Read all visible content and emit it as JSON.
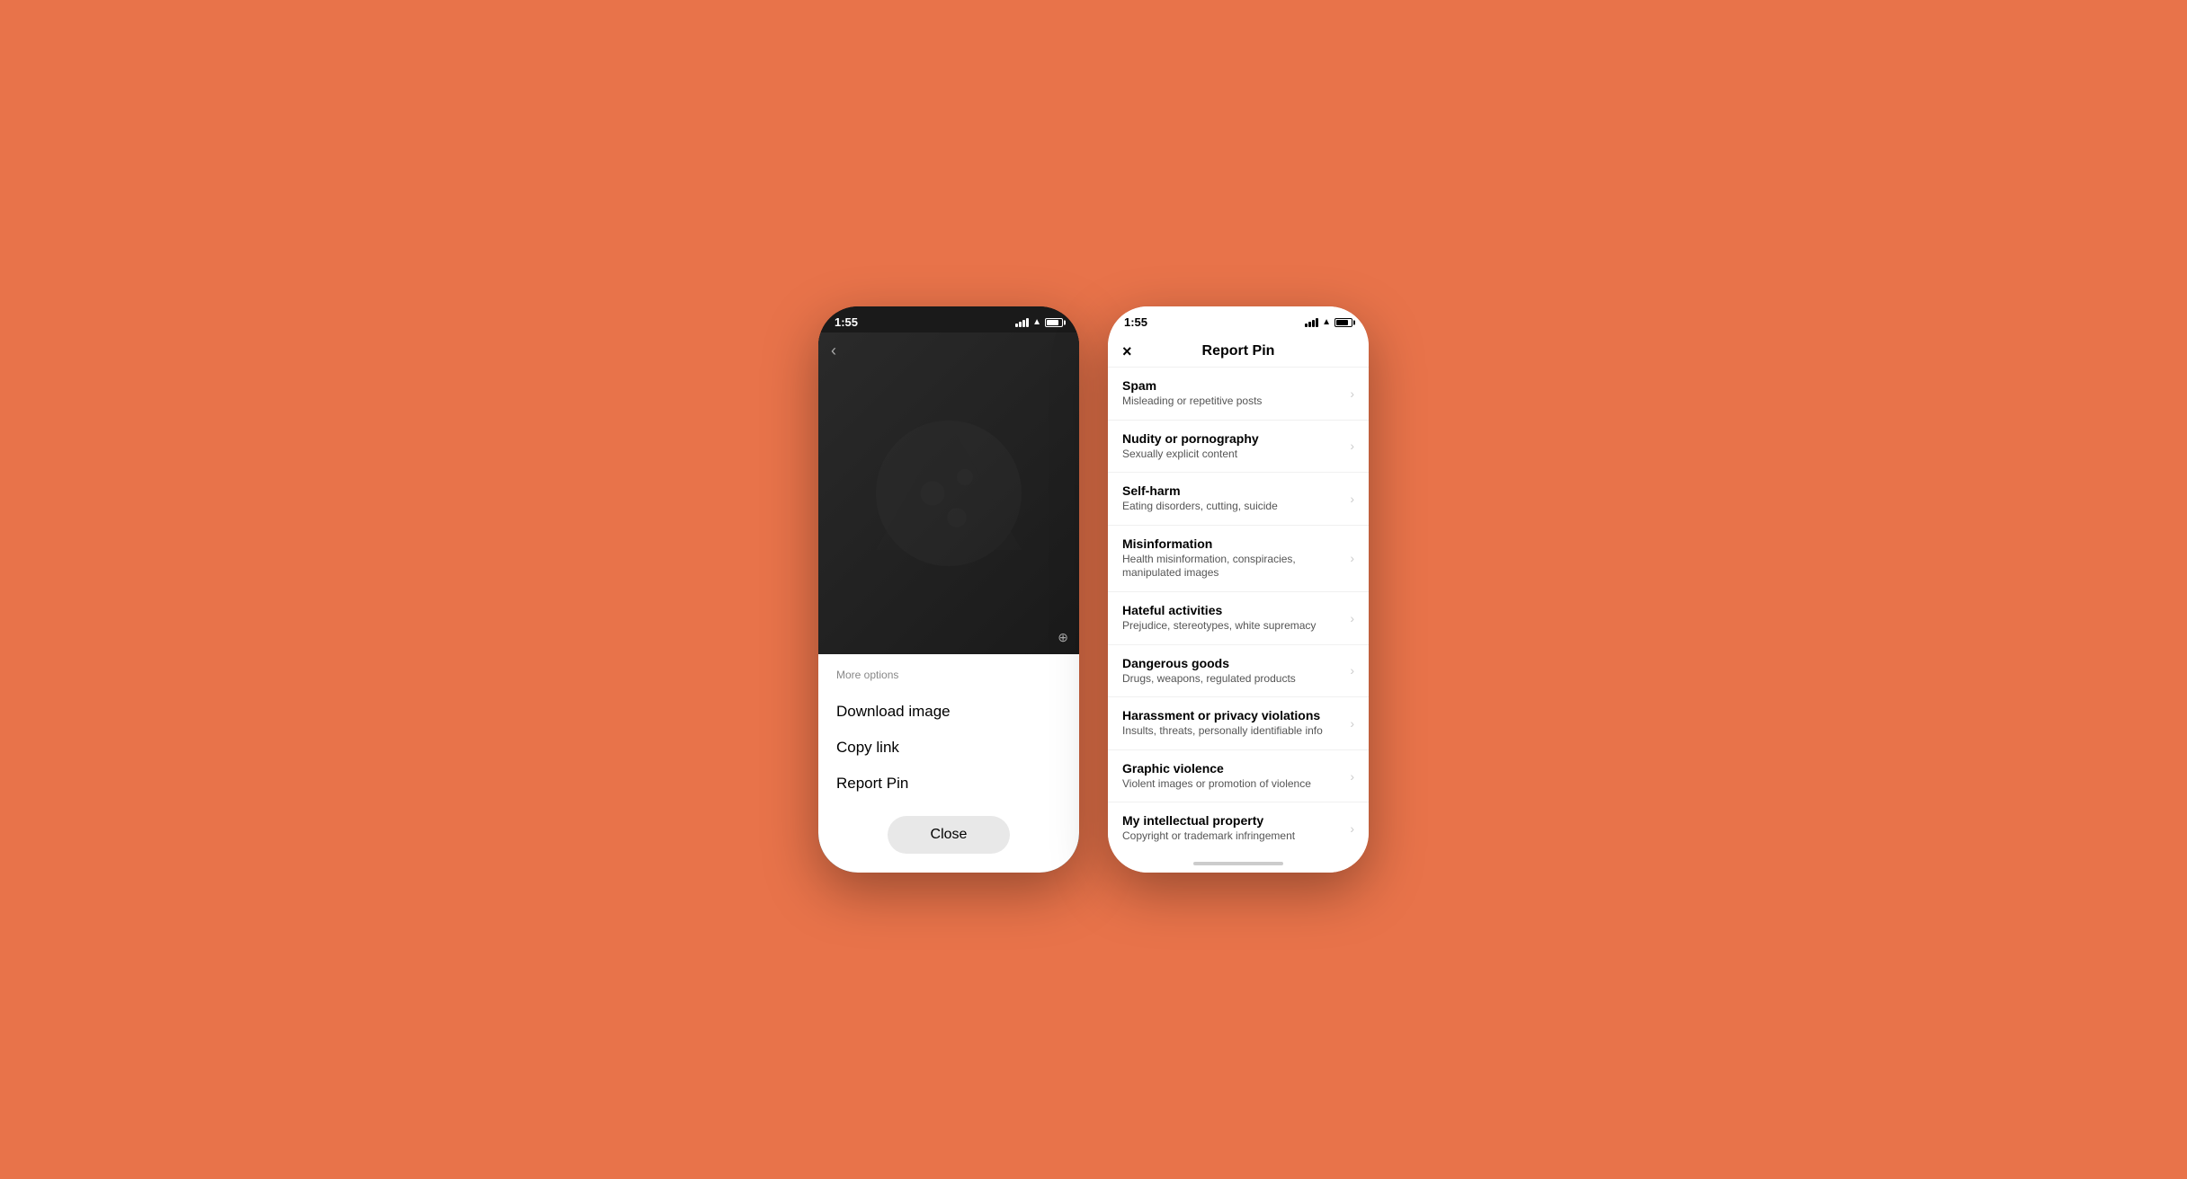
{
  "background_color": "#E8734A",
  "left_phone": {
    "status_bar": {
      "time": "1:55",
      "signal": true,
      "wifi": true,
      "battery": true
    },
    "more_options_label": "More options",
    "menu_items": [
      {
        "id": "download-image",
        "label": "Download image"
      },
      {
        "id": "copy-link",
        "label": "Copy link"
      },
      {
        "id": "report-pin",
        "label": "Report Pin"
      }
    ],
    "close_button_label": "Close"
  },
  "right_phone": {
    "status_bar": {
      "time": "1:55",
      "signal": true,
      "wifi": true,
      "battery": true
    },
    "header": {
      "close_icon": "×",
      "title": "Report Pin"
    },
    "report_items": [
      {
        "id": "spam",
        "title": "Spam",
        "subtitle": "Misleading or repetitive posts"
      },
      {
        "id": "nudity",
        "title": "Nudity or pornography",
        "subtitle": "Sexually explicit content"
      },
      {
        "id": "self-harm",
        "title": "Self-harm",
        "subtitle": "Eating disorders, cutting, suicide"
      },
      {
        "id": "misinformation",
        "title": "Misinformation",
        "subtitle": "Health misinformation, conspiracies, manipulated images"
      },
      {
        "id": "hateful",
        "title": "Hateful activities",
        "subtitle": "Prejudice, stereotypes, white supremacy"
      },
      {
        "id": "dangerous",
        "title": "Dangerous goods",
        "subtitle": "Drugs, weapons, regulated products"
      },
      {
        "id": "harassment",
        "title": "Harassment or privacy violations",
        "subtitle": "Insults, threats, personally identifiable info"
      },
      {
        "id": "graphic-violence",
        "title": "Graphic violence",
        "subtitle": "Violent images or promotion of violence"
      },
      {
        "id": "intellectual-property",
        "title": "My intellectual property",
        "subtitle": "Copyright or trademark infringement"
      }
    ]
  }
}
